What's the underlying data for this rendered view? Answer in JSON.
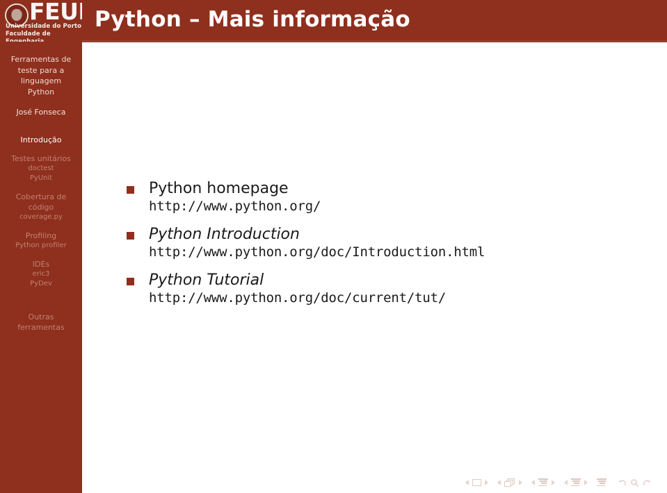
{
  "theme": {
    "brand_color": "#8f2f1d",
    "content_bg": "#ffffff",
    "active_nav_color": "#ffffff",
    "dim_nav_color": "#c08374",
    "body_text_color": "#1a1a1a"
  },
  "logo": {
    "wordmark": "FEUP",
    "line1": "Universidade do Porto",
    "line2": "Faculdade de Engenharia",
    "crest_icon": "feup-crest-icon"
  },
  "header": {
    "title": "Python – Mais informação"
  },
  "sidebar": {
    "deck_title": "Ferramentas de teste para a linguagem Python",
    "author": "José Fonseca",
    "sections": [
      {
        "label": "Introdução",
        "active": true,
        "subitems": []
      },
      {
        "label": "Testes unitários",
        "active": false,
        "subitems": [
          {
            "label": "doctest",
            "active": false
          },
          {
            "label": "PyUnit",
            "active": false
          }
        ]
      },
      {
        "label": "Cobertura de código",
        "active": false,
        "subitems": [
          {
            "label": "coverage.py",
            "active": false
          }
        ]
      },
      {
        "label": "Profiling",
        "active": false,
        "subitems": [
          {
            "label": "Python profiler",
            "active": false
          }
        ]
      },
      {
        "label": "IDEs",
        "active": false,
        "subitems": [
          {
            "label": "eric3",
            "active": false
          },
          {
            "label": "PyDev",
            "active": false
          }
        ]
      },
      {
        "label": "Outras ferramentas",
        "active": false,
        "subitems": []
      }
    ]
  },
  "main": {
    "items": [
      {
        "title": "Python homepage",
        "italic": false,
        "url": "http://www.python.org/"
      },
      {
        "title": "Python Introduction",
        "italic": true,
        "url": "http://www.python.org/doc/Introduction.html"
      },
      {
        "title": "Python Tutorial",
        "italic": true,
        "url": "http://www.python.org/doc/current/tut/"
      }
    ]
  },
  "navbar": {
    "groups": [
      {
        "icon": "slide-icon",
        "prev": "prev-slide",
        "next": "next-slide"
      },
      {
        "icon": "frames-icon",
        "prev": "prev-frame",
        "next": "next-frame"
      },
      {
        "icon": "subsection-icon",
        "prev": "prev-subsection",
        "next": "next-subsection"
      },
      {
        "icon": "section-icon",
        "prev": "prev-section",
        "next": "next-section"
      }
    ],
    "presentation_icon": "presentation-icon",
    "back_icon": "back-arrow-icon",
    "search_icon": "search-icon",
    "forward_icon": "forward-arrow-icon"
  }
}
